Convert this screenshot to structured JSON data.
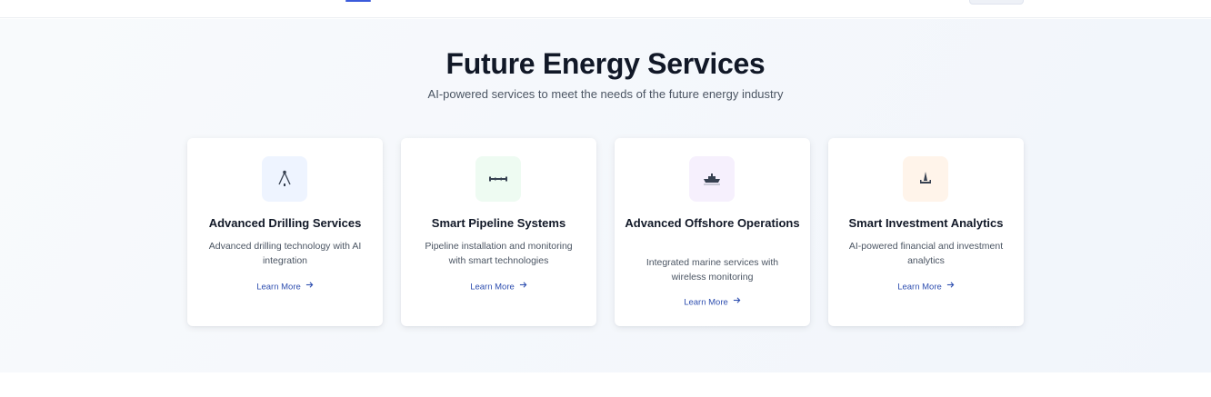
{
  "section": {
    "title": "Future Energy Services",
    "subtitle": "AI-powered services to meet the needs of the future energy industry"
  },
  "cards": [
    {
      "title": "Advanced Drilling Services",
      "description": "Advanced drilling technology with AI integration",
      "link_label": "Learn More",
      "icon": "drilling-rig-icon",
      "icon_bg": "#eef4ff"
    },
    {
      "title": "Smart Pipeline Systems",
      "description": "Pipeline installation and monitoring with smart technologies",
      "link_label": "Learn More",
      "icon": "pipeline-icon",
      "icon_bg": "#eefbf2"
    },
    {
      "title": "Advanced Offshore Operations",
      "description": "Integrated marine services with wireless monitoring",
      "link_label": "Learn More",
      "icon": "offshore-ship-icon",
      "icon_bg": "#f6f0fd"
    },
    {
      "title": "Smart Investment Analytics",
      "description": "AI-powered financial and investment analytics",
      "link_label": "Learn More",
      "icon": "oil-platform-icon",
      "icon_bg": "#fff4ea"
    }
  ],
  "colors": {
    "link": "#2f4fb0",
    "heading": "#111827",
    "body_text": "#4b5563"
  }
}
